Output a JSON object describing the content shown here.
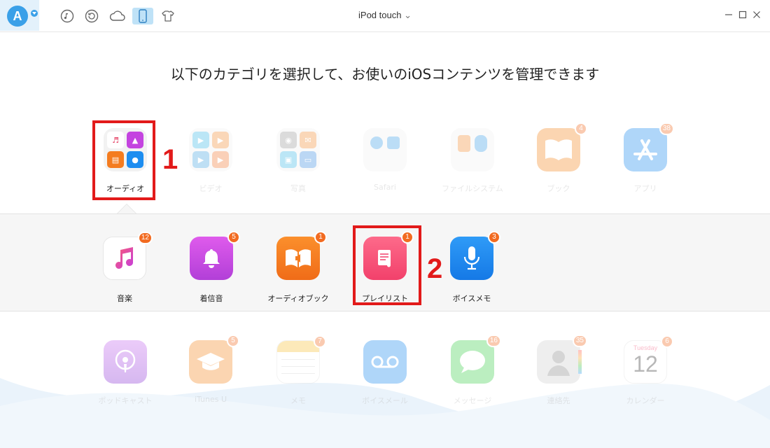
{
  "window": {
    "app_logo_letter": "A",
    "device_title": "iPod touch",
    "device_caret": "⌄"
  },
  "toolbar": {
    "icons": [
      "music-icon",
      "restore-icon",
      "cloud-icon",
      "device-icon",
      "shirt-icon"
    ]
  },
  "heading": "以下のカテゴリを選択して、お使いのiOSコンテンツを管理できます",
  "categories": [
    {
      "label": "オーディオ"
    },
    {
      "label": "ビデオ"
    },
    {
      "label": "写真"
    },
    {
      "label": "Safari"
    },
    {
      "label": "ファイルシステム"
    },
    {
      "label": "ブック",
      "badge": "4"
    },
    {
      "label": "アプリ",
      "badge": "38"
    }
  ],
  "audio_sub": [
    {
      "label": "音楽",
      "badge": "12"
    },
    {
      "label": "着信音",
      "badge": "5"
    },
    {
      "label": "オーディオブック",
      "badge": "1"
    },
    {
      "label": "プレイリスト",
      "badge": "1"
    },
    {
      "label": "ボイスメモ",
      "badge": "3"
    }
  ],
  "more": [
    {
      "label": "ポッドキャスト"
    },
    {
      "label": "iTunes U",
      "badge": "5"
    },
    {
      "label": "メモ",
      "badge": "7"
    },
    {
      "label": "ボイスメール"
    },
    {
      "label": "メッセージ",
      "badge": "16"
    },
    {
      "label": "連絡先",
      "badge": "35"
    },
    {
      "label": "カレンダー",
      "badge": "6",
      "cal_day": "Tuesday",
      "cal_date": "12"
    }
  ],
  "steps": {
    "one": "1",
    "two": "2"
  },
  "colors": {
    "accent": "#3aa0e8",
    "badge": "#f26b21",
    "highlight": "#e21a1a"
  }
}
